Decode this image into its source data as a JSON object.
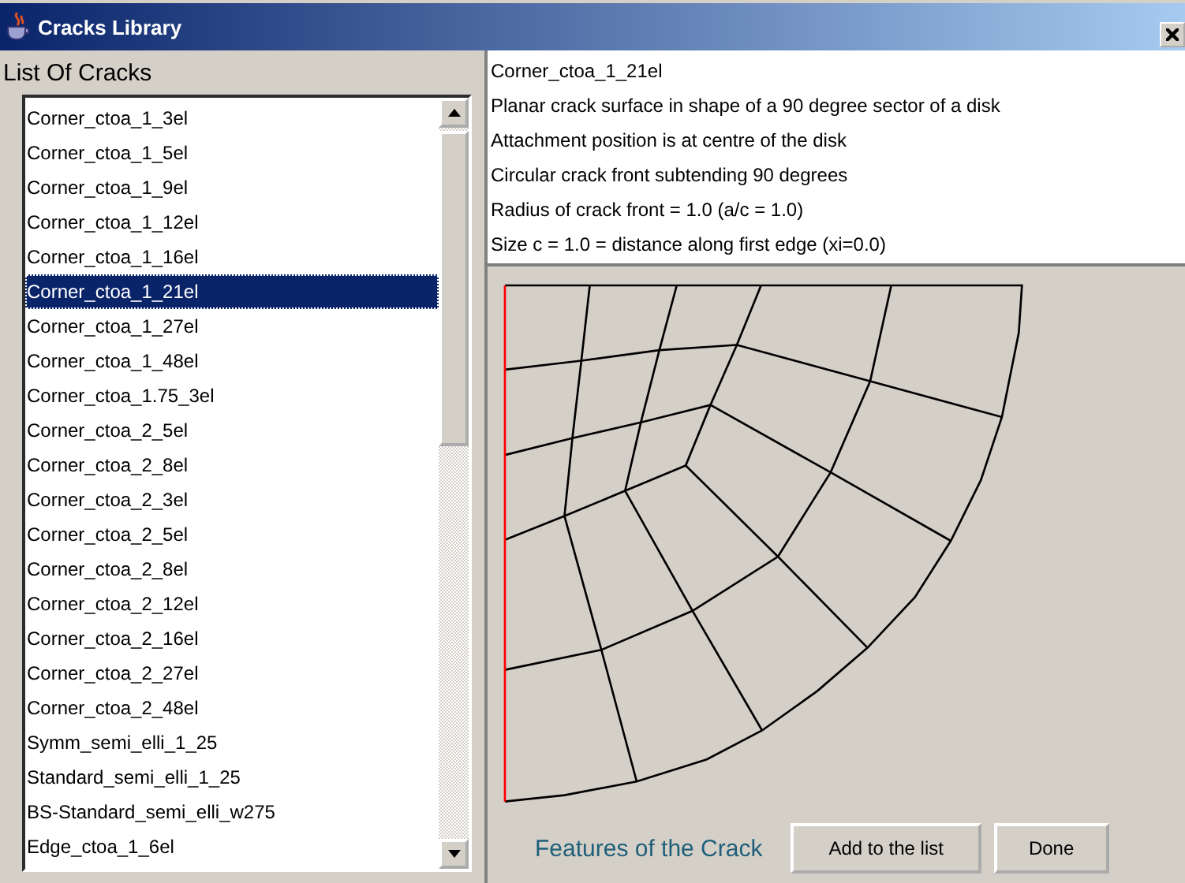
{
  "window": {
    "title": "Cracks Library"
  },
  "list_label": "List Of Cracks",
  "cracks": [
    {
      "name": "Corner_ctoa_1_3el",
      "selected": false
    },
    {
      "name": "Corner_ctoa_1_5el",
      "selected": false
    },
    {
      "name": "Corner_ctoa_1_9el",
      "selected": false
    },
    {
      "name": "Corner_ctoa_1_12el",
      "selected": false
    },
    {
      "name": "Corner_ctoa_1_16el",
      "selected": false
    },
    {
      "name": "Corner_ctoa_1_21el",
      "selected": true
    },
    {
      "name": "Corner_ctoa_1_27el",
      "selected": false
    },
    {
      "name": "Corner_ctoa_1_48el",
      "selected": false
    },
    {
      "name": "Corner_ctoa_1.75_3el",
      "selected": false
    },
    {
      "name": "Corner_ctoa_2_5el",
      "selected": false
    },
    {
      "name": "Corner_ctoa_2_8el",
      "selected": false
    },
    {
      "name": "Corner_ctoa_2_3el",
      "selected": false
    },
    {
      "name": "Corner_ctoa_2_5el",
      "selected": false
    },
    {
      "name": "Corner_ctoa_2_8el",
      "selected": false
    },
    {
      "name": "Corner_ctoa_2_12el",
      "selected": false
    },
    {
      "name": "Corner_ctoa_2_16el",
      "selected": false
    },
    {
      "name": "Corner_ctoa_2_27el",
      "selected": false
    },
    {
      "name": "Corner_ctoa_2_48el",
      "selected": false
    },
    {
      "name": "Symm_semi_elli_1_25",
      "selected": false
    },
    {
      "name": "Standard_semi_elli_1_25",
      "selected": false
    },
    {
      "name": "BS-Standard_semi_elli_w275",
      "selected": false
    },
    {
      "name": "Edge_ctoa_1_6el",
      "selected": false
    }
  ],
  "description": [
    "Corner_ctoa_1_21el",
    "Planar crack surface in shape of a 90 degree sector of a disk",
    "Attachment position is at centre of the disk",
    "Circular crack front subtending 90 degrees",
    "Radius of crack front = 1.0 (a/c = 1.0)",
    "Size c = 1.0 = distance along first edge (xi=0.0)"
  ],
  "features_label": "Features of the Crack",
  "buttons": [
    "Add to the list",
    "Done"
  ]
}
